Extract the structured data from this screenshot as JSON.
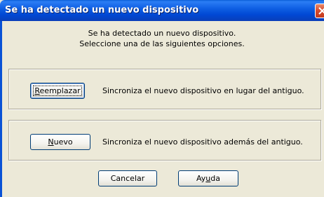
{
  "window": {
    "title": "Se ha detectado un nuevo dispositivo",
    "close_icon": "close-icon"
  },
  "intro": {
    "line1": "Se ha detectado un nuevo dispositivo.",
    "line2": "Seleccione una de las siguientes opciones."
  },
  "options": {
    "replace": {
      "button_mnemonic": "R",
      "button_rest": "eemplazar",
      "description": "Sincroniza el nuevo dispositivo en lugar del antiguo."
    },
    "new": {
      "button_mnemonic": "N",
      "button_rest": "uevo",
      "description": "Sincroniza el nuevo dispositivo además del antiguo."
    }
  },
  "footer": {
    "cancel_label": "Cancelar",
    "help_pre": "Ay",
    "help_mnemonic": "u",
    "help_post": "da"
  },
  "colors": {
    "titlebar": "#0a5fd8",
    "dialog_background": "#ece9d8",
    "close_button": "#d6492b"
  }
}
